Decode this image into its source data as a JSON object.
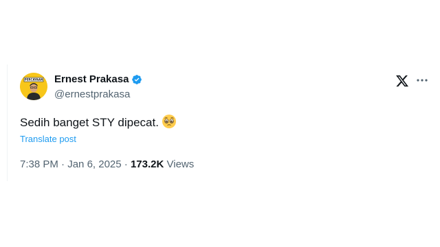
{
  "tweet": {
    "author_name": "Ernest Prakasa",
    "handle": "@ernestprakasa",
    "verified": true,
    "avatar_caption": "PERCAYAAN",
    "text": "Sedih banget STY dipecat.",
    "emoji": "pleading-face",
    "translate_label": "Translate post",
    "time": "7:38 PM",
    "separator": " · ",
    "date": "Jan 6, 2025",
    "views_count": "173.2K",
    "views_label": "Views"
  },
  "colors": {
    "accent": "#1d9bf0",
    "text": "#0f1419",
    "muted": "#536471",
    "avatar_bg": "#f7c61a"
  },
  "icons": {
    "verified": "verified-badge-icon",
    "logo": "x-logo-icon",
    "more": "more-options-icon"
  }
}
